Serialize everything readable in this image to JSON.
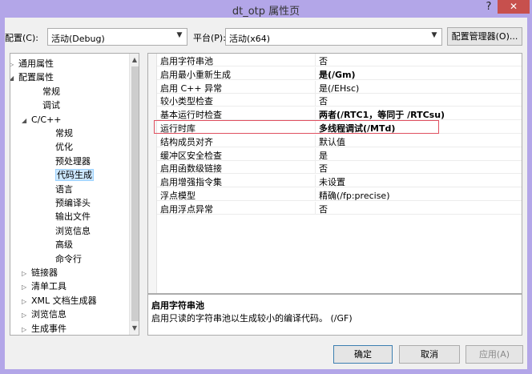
{
  "window": {
    "title": "dt_otp 属性页",
    "help": "?",
    "close": "✕"
  },
  "toolbar": {
    "config_label": "配置(C):",
    "config_value": "活动(Debug)",
    "platform_label": "平台(P):",
    "platform_value": "活动(x64)",
    "manager_button": "配置管理器(O)..."
  },
  "tree": {
    "items": [
      {
        "label": "通用属性",
        "expander": "▷"
      },
      {
        "label": "配置属性",
        "expander": "◢"
      },
      {
        "label": "常规",
        "expander": ""
      },
      {
        "label": "调试",
        "expander": ""
      },
      {
        "label": "C/C++",
        "expander": "◢"
      },
      {
        "label": "常规",
        "expander": ""
      },
      {
        "label": "优化",
        "expander": ""
      },
      {
        "label": "预处理器",
        "expander": ""
      },
      {
        "label": "代码生成",
        "expander": ""
      },
      {
        "label": "语言",
        "expander": ""
      },
      {
        "label": "预编译头",
        "expander": ""
      },
      {
        "label": "输出文件",
        "expander": ""
      },
      {
        "label": "浏览信息",
        "expander": ""
      },
      {
        "label": "高级",
        "expander": ""
      },
      {
        "label": "命令行",
        "expander": ""
      },
      {
        "label": "链接器",
        "expander": "▷"
      },
      {
        "label": "清单工具",
        "expander": "▷"
      },
      {
        "label": "XML 文档生成器",
        "expander": "▷"
      },
      {
        "label": "浏览信息",
        "expander": "▷"
      },
      {
        "label": "生成事件",
        "expander": "▷"
      }
    ],
    "scroll_up": "▲",
    "scroll_down": "▼"
  },
  "properties": {
    "rows": [
      {
        "name": "启用字符串池",
        "value": "否"
      },
      {
        "name": "启用最小重新生成",
        "value": "是(/Gm)"
      },
      {
        "name": "启用 C++ 异常",
        "value": "是(/EHsc)"
      },
      {
        "name": "较小类型检查",
        "value": "否"
      },
      {
        "name": "基本运行时检查",
        "value": "两者(/RTC1，等同于 /RTCsu)"
      },
      {
        "name": "运行时库",
        "value": "多线程调试(/MTd)"
      },
      {
        "name": "结构成员对齐",
        "value": "默认值"
      },
      {
        "name": "缓冲区安全检查",
        "value": "是"
      },
      {
        "name": "启用函数级链接",
        "value": "否"
      },
      {
        "name": "启用增强指令集",
        "value": "未设置"
      },
      {
        "name": "浮点模型",
        "value": "精确(/fp:precise)"
      },
      {
        "name": "启用浮点异常",
        "value": "否"
      }
    ]
  },
  "description": {
    "title": "启用字符串池",
    "text": "启用只读的字符串池以生成较小的编译代码。     (/GF)"
  },
  "footer": {
    "ok": "确定",
    "cancel": "取消",
    "apply": "应用(A)"
  }
}
